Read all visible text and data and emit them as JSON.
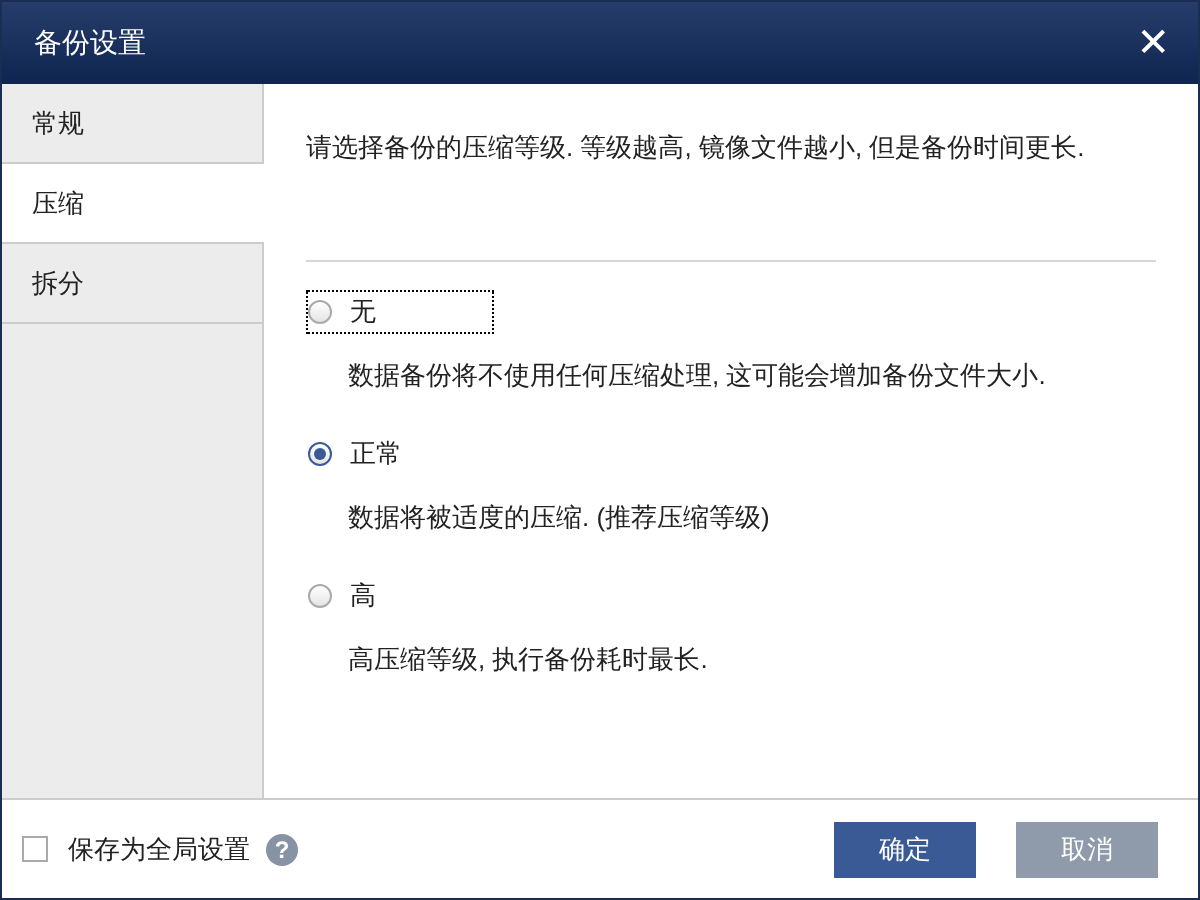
{
  "window": {
    "title": "备份设置",
    "close": "✕"
  },
  "tabs": [
    {
      "label": "常规",
      "selected": false
    },
    {
      "label": "压缩",
      "selected": true
    },
    {
      "label": "拆分",
      "selected": false
    }
  ],
  "description": "请选择备份的压缩等级. 等级越高, 镜像文件越小, 但是备份时间更长.",
  "options": [
    {
      "label": "无",
      "selected": false,
      "focused": true,
      "description": "数据备份将不使用任何压缩处理, 这可能会增加备份文件大小."
    },
    {
      "label": "正常",
      "selected": true,
      "focused": false,
      "description": "数据将被适度的压缩. (推荐压缩等级)"
    },
    {
      "label": "高",
      "selected": false,
      "focused": false,
      "description": "高压缩等级, 执行备份耗时最长."
    }
  ],
  "footer": {
    "checkbox": {
      "label": "保存为全局设置",
      "checked": false
    },
    "help": "?"
  },
  "buttons": [
    {
      "label": "确定",
      "kind": "primary"
    },
    {
      "label": "取消",
      "kind": "secondary"
    }
  ]
}
